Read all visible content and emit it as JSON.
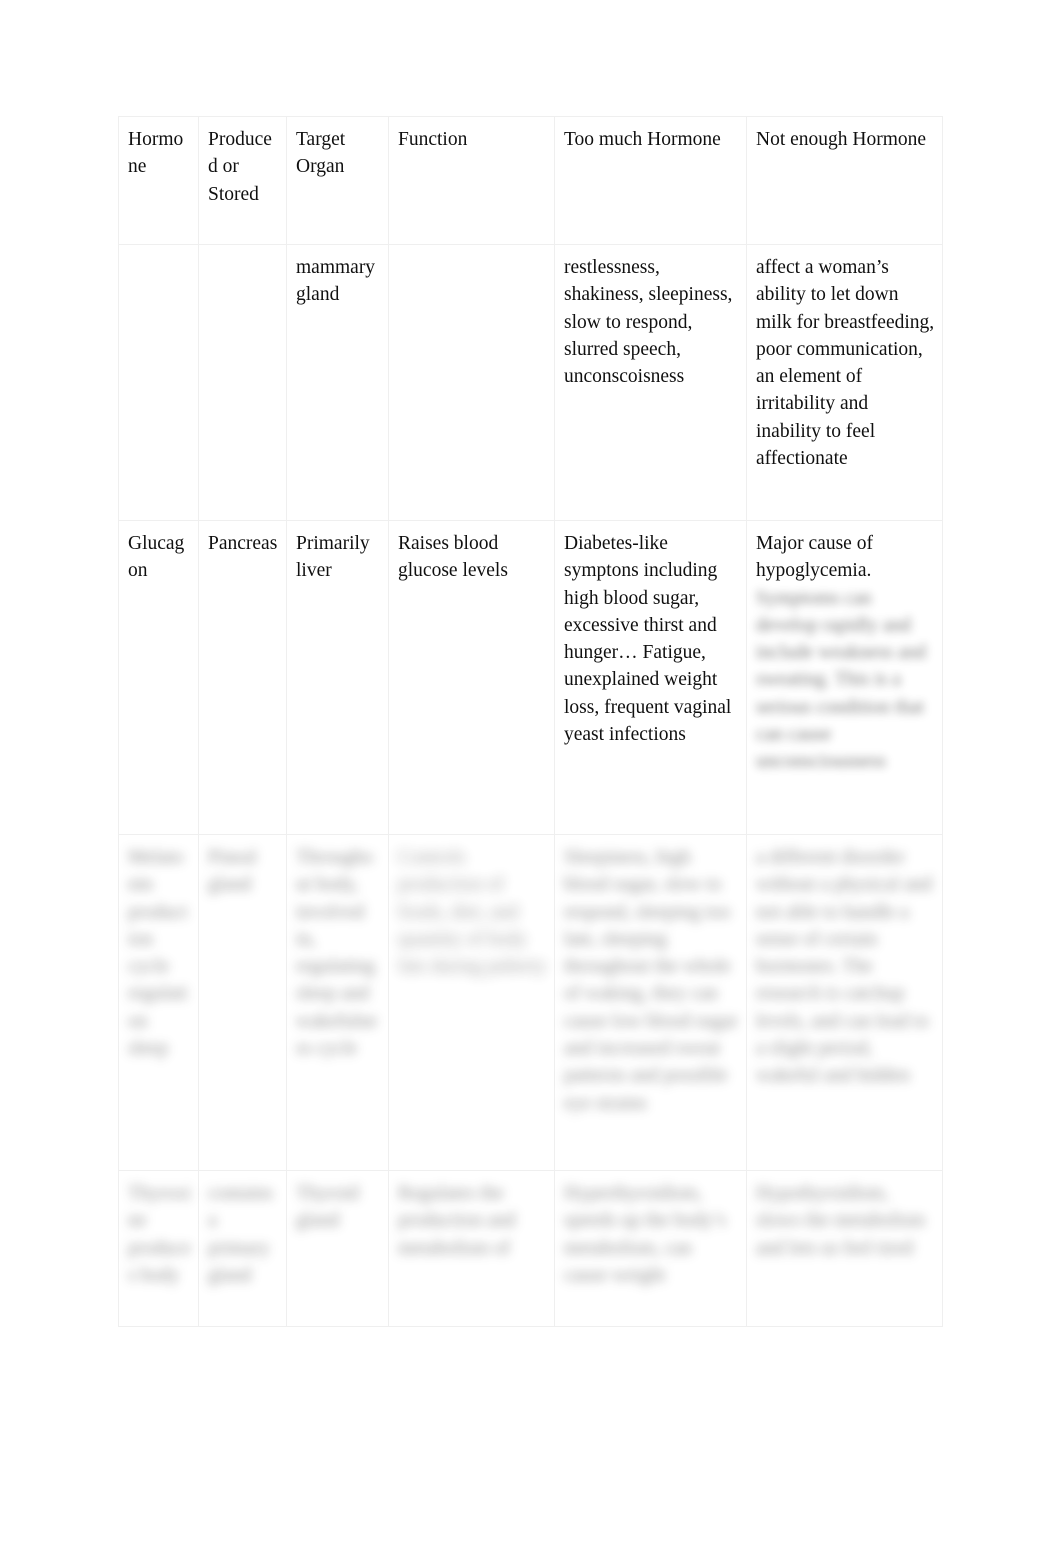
{
  "document": {
    "type": "table",
    "page_background": "#ffffff",
    "text_color": "#101010",
    "border_color": "#efefef"
  },
  "table": {
    "headers": [
      "Hormone",
      "Produced or Stored",
      "Target Organ",
      "Function",
      "Too much Hormone",
      "Not enough Hormone"
    ],
    "rows": [
      {
        "id": "row-oxytocin",
        "legible": true,
        "cells": {
          "hormone": "",
          "produced_or_stored": "",
          "target_organ": "mammary gland",
          "function": "",
          "too_much": "restlessness, shakiness, sleepiness, slow to respond, slurred speech, unconscoisness",
          "not_enough": "affect a woman’s ability to let down milk for breastfeeding, poor communication, an element of irritability and inability to feel affectionate"
        }
      },
      {
        "id": "row-glucagon",
        "legible": true,
        "cells": {
          "hormone": "Glucagon",
          "produced_or_stored": "Pancreas",
          "target_organ": "Primarily liver",
          "function": "Raises blood glucose levels",
          "too_much": "Diabetes-like symptons including high blood sugar, excessive thirst and hunger… Fatigue, unexplained weight loss, frequent vaginal yeast infections",
          "not_enough": "Major cause of hypoglycemia.",
          "not_enough_redacted": "Symptoms can develop rapidly and include weakness and sweating. This is a serious condition that can cause unconsciousness"
        }
      },
      {
        "id": "row-redacted-a",
        "legible": false,
        "cells": {
          "hormone": "Melatonin production cycle regulation sleep",
          "produced_or_stored": "Pineal gland",
          "target_organ": "Throughout body, involved in, regulating sleep and wakefulness cycle",
          "function": "Controls production of foods, diet, and quantity of body fats during puberty",
          "too_much": "Sleepiness, high blood sugar, slow to respond, sleeping too late, sleeping throughout the whole of waking, they can cause low blood sugar and increased sweat patterns and possible eye strains",
          "not_enough": "a different disorder without a physical and not able to handle a sense of certain hormones. The research is catchup levels, and can lead to a slight period, wakeful and hidden"
        }
      },
      {
        "id": "row-redacted-b",
        "legible": false,
        "cells": {
          "hormone": "Thyroxine produces body",
          "produced_or_stored": "contains a primary gland",
          "target_organ": "Thyroid gland",
          "function": "Regulates the production and metabolism of",
          "too_much": "Hyperthyroidism, speeds up the body’s metabolism, can cause weight",
          "not_enough": "Hypothyroidism, slows the metabolism and lets us feel tired"
        }
      }
    ]
  }
}
